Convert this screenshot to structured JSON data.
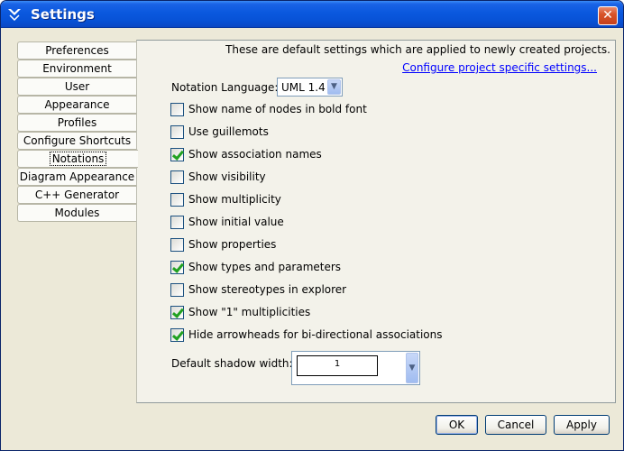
{
  "window": {
    "title": "Settings",
    "close_label": "✕"
  },
  "tabs": [
    {
      "label": "Preferences"
    },
    {
      "label": "Environment"
    },
    {
      "label": "User"
    },
    {
      "label": "Appearance"
    },
    {
      "label": "Profiles"
    },
    {
      "label": "Configure Shortcuts"
    },
    {
      "label": "Notations",
      "selected": true
    },
    {
      "label": "Diagram Appearance"
    },
    {
      "label": "C++ Generator"
    },
    {
      "label": "Modules"
    }
  ],
  "panel": {
    "notice": "These are default settings which are applied to newly created projects.",
    "project_link": "Configure project specific settings...",
    "notation_label": "Notation Language:",
    "notation_value": "UML 1.4",
    "options": [
      {
        "label": "Show name of nodes in bold font",
        "checked": false
      },
      {
        "label": "Use guillemots",
        "checked": false
      },
      {
        "label": "Show association names",
        "checked": true
      },
      {
        "label": "Show visibility",
        "checked": false
      },
      {
        "label": "Show multiplicity",
        "checked": false
      },
      {
        "label": "Show initial value",
        "checked": false
      },
      {
        "label": "Show properties",
        "checked": false
      },
      {
        "label": "Show types and parameters",
        "checked": true
      },
      {
        "label": "Show stereotypes in explorer",
        "checked": false
      },
      {
        "label": "Show \"1\" multiplicities",
        "checked": true
      },
      {
        "label": "Hide arrowheads for bi-directional associations",
        "checked": true
      }
    ],
    "shadow_label": "Default shadow width:",
    "shadow_value": "1"
  },
  "buttons": {
    "ok": "OK",
    "cancel": "Cancel",
    "apply": "Apply"
  }
}
